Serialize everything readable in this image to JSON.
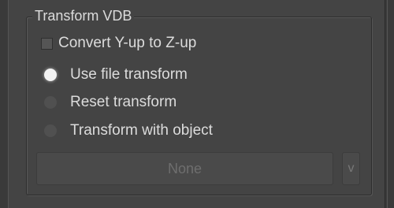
{
  "group": {
    "title": "Transform VDB"
  },
  "options": {
    "convert_checkbox_label": "Convert Y-up to Z-up",
    "radio_use_file": "Use file transform",
    "radio_reset": "Reset transform",
    "radio_with_object": "Transform with object",
    "selected_radio": "Use file transform"
  },
  "object_picker": {
    "value": "None",
    "button_label": "v"
  }
}
